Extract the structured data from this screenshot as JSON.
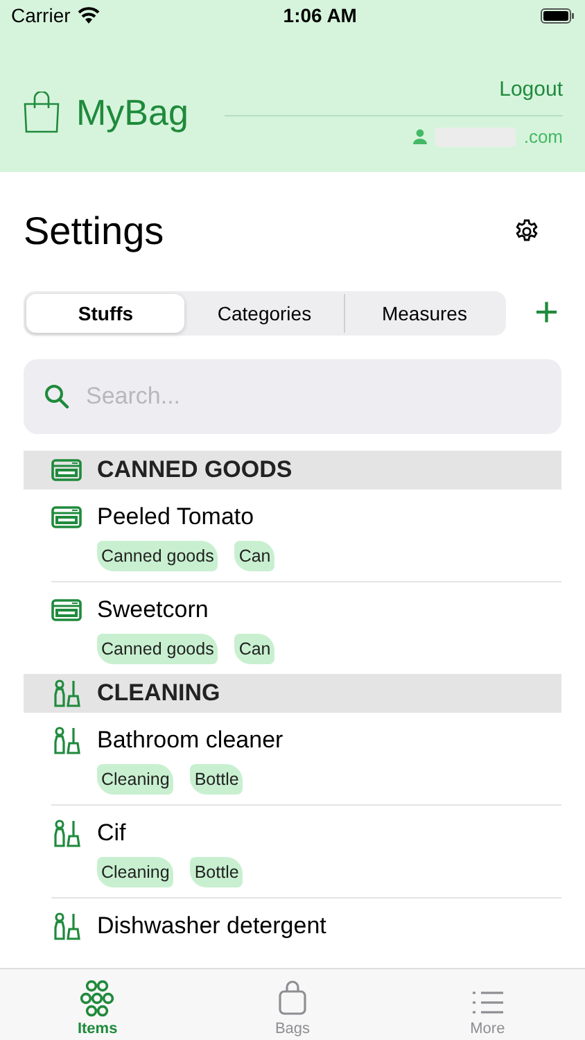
{
  "status_bar": {
    "carrier": "Carrier",
    "time": "1:06 AM"
  },
  "header": {
    "app_name": "MyBag",
    "logout": "Logout",
    "email_suffix": ".com"
  },
  "title": "Settings",
  "segments": [
    {
      "label": "Stuffs",
      "selected": true
    },
    {
      "label": "Categories",
      "selected": false
    },
    {
      "label": "Measures",
      "selected": false
    }
  ],
  "add_button": "+",
  "search": {
    "placeholder": "Search..."
  },
  "sections": [
    {
      "title": "CANNED GOODS",
      "kind": "can",
      "items": [
        {
          "name": "Peeled Tomato",
          "tags": [
            "Canned goods",
            "Can"
          ]
        },
        {
          "name": "Sweetcorn",
          "tags": [
            "Canned goods",
            "Can"
          ]
        }
      ]
    },
    {
      "title": "CLEANING",
      "kind": "cleaning",
      "items": [
        {
          "name": "Bathroom cleaner",
          "tags": [
            "Cleaning",
            "Bottle"
          ]
        },
        {
          "name": "Cif",
          "tags": [
            "Cleaning",
            "Bottle"
          ]
        },
        {
          "name": "Dishwasher detergent"
        }
      ]
    }
  ],
  "tab_bar": [
    {
      "label": "Items",
      "kind": "items",
      "selected": true
    },
    {
      "label": "Bags",
      "kind": "bags",
      "selected": false
    },
    {
      "label": "More",
      "kind": "more",
      "selected": false
    }
  ]
}
